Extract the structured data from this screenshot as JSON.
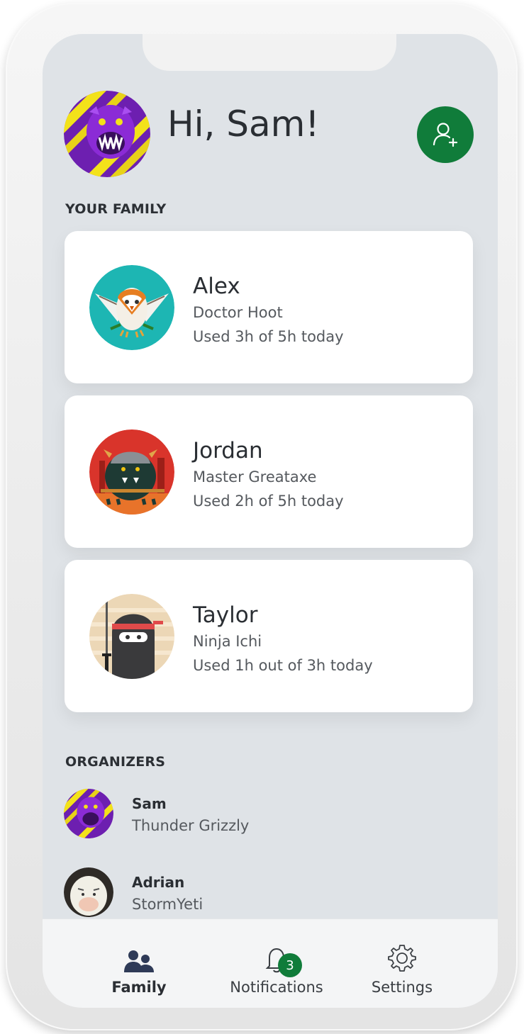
{
  "header": {
    "greeting": "Hi, Sam!",
    "add_member_icon": "add-person-icon"
  },
  "family": {
    "section_title": "YOUR FAMILY",
    "members": [
      {
        "name": "Alex",
        "gamertag": "Doctor Hoot",
        "usage": "Used 3h of 5h today",
        "avatar": "owl-avatar"
      },
      {
        "name": "Jordan",
        "gamertag": "Master Greataxe",
        "usage": "Used 2h of 5h today",
        "avatar": "monster-avatar"
      },
      {
        "name": "Taylor",
        "gamertag": "Ninja Ichi",
        "usage": "Used 1h out of 3h today",
        "avatar": "ninja-avatar"
      }
    ]
  },
  "organizers": {
    "section_title": "ORGANIZERS",
    "people": [
      {
        "name": "Sam",
        "gamertag": "Thunder Grizzly",
        "avatar": "grizzly-avatar"
      },
      {
        "name": "Adrian",
        "gamertag": "StormYeti",
        "avatar": "yeti-avatar"
      }
    ]
  },
  "tabbar": {
    "tabs": [
      {
        "label": "Family",
        "icon": "family-icon",
        "active": true
      },
      {
        "label": "Notifications",
        "icon": "bell-icon",
        "badge": "3"
      },
      {
        "label": "Settings",
        "icon": "gear-icon"
      }
    ]
  },
  "colors": {
    "accent": "#107c3a",
    "screen_bg": "#dfe3e7",
    "card_bg": "#ffffff",
    "tabbar_bg": "#f4f5f6",
    "text_primary": "#2a2e33",
    "text_secondary": "#55595e"
  }
}
